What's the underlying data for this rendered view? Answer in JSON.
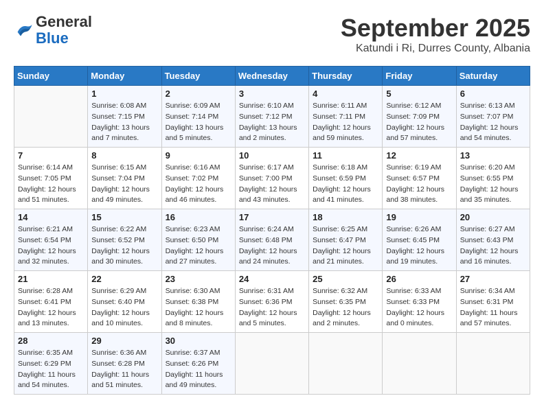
{
  "header": {
    "logo": {
      "general": "General",
      "blue": "Blue"
    },
    "title": "September 2025",
    "subtitle": "Katundi i Ri, Durres County, Albania"
  },
  "weekdays": [
    "Sunday",
    "Monday",
    "Tuesday",
    "Wednesday",
    "Thursday",
    "Friday",
    "Saturday"
  ],
  "weeks": [
    [
      {
        "day": "",
        "info": ""
      },
      {
        "day": "1",
        "info": "Sunrise: 6:08 AM\nSunset: 7:15 PM\nDaylight: 13 hours\nand 7 minutes."
      },
      {
        "day": "2",
        "info": "Sunrise: 6:09 AM\nSunset: 7:14 PM\nDaylight: 13 hours\nand 5 minutes."
      },
      {
        "day": "3",
        "info": "Sunrise: 6:10 AM\nSunset: 7:12 PM\nDaylight: 13 hours\nand 2 minutes."
      },
      {
        "day": "4",
        "info": "Sunrise: 6:11 AM\nSunset: 7:11 PM\nDaylight: 12 hours\nand 59 minutes."
      },
      {
        "day": "5",
        "info": "Sunrise: 6:12 AM\nSunset: 7:09 PM\nDaylight: 12 hours\nand 57 minutes."
      },
      {
        "day": "6",
        "info": "Sunrise: 6:13 AM\nSunset: 7:07 PM\nDaylight: 12 hours\nand 54 minutes."
      }
    ],
    [
      {
        "day": "7",
        "info": "Sunrise: 6:14 AM\nSunset: 7:05 PM\nDaylight: 12 hours\nand 51 minutes."
      },
      {
        "day": "8",
        "info": "Sunrise: 6:15 AM\nSunset: 7:04 PM\nDaylight: 12 hours\nand 49 minutes."
      },
      {
        "day": "9",
        "info": "Sunrise: 6:16 AM\nSunset: 7:02 PM\nDaylight: 12 hours\nand 46 minutes."
      },
      {
        "day": "10",
        "info": "Sunrise: 6:17 AM\nSunset: 7:00 PM\nDaylight: 12 hours\nand 43 minutes."
      },
      {
        "day": "11",
        "info": "Sunrise: 6:18 AM\nSunset: 6:59 PM\nDaylight: 12 hours\nand 41 minutes."
      },
      {
        "day": "12",
        "info": "Sunrise: 6:19 AM\nSunset: 6:57 PM\nDaylight: 12 hours\nand 38 minutes."
      },
      {
        "day": "13",
        "info": "Sunrise: 6:20 AM\nSunset: 6:55 PM\nDaylight: 12 hours\nand 35 minutes."
      }
    ],
    [
      {
        "day": "14",
        "info": "Sunrise: 6:21 AM\nSunset: 6:54 PM\nDaylight: 12 hours\nand 32 minutes."
      },
      {
        "day": "15",
        "info": "Sunrise: 6:22 AM\nSunset: 6:52 PM\nDaylight: 12 hours\nand 30 minutes."
      },
      {
        "day": "16",
        "info": "Sunrise: 6:23 AM\nSunset: 6:50 PM\nDaylight: 12 hours\nand 27 minutes."
      },
      {
        "day": "17",
        "info": "Sunrise: 6:24 AM\nSunset: 6:48 PM\nDaylight: 12 hours\nand 24 minutes."
      },
      {
        "day": "18",
        "info": "Sunrise: 6:25 AM\nSunset: 6:47 PM\nDaylight: 12 hours\nand 21 minutes."
      },
      {
        "day": "19",
        "info": "Sunrise: 6:26 AM\nSunset: 6:45 PM\nDaylight: 12 hours\nand 19 minutes."
      },
      {
        "day": "20",
        "info": "Sunrise: 6:27 AM\nSunset: 6:43 PM\nDaylight: 12 hours\nand 16 minutes."
      }
    ],
    [
      {
        "day": "21",
        "info": "Sunrise: 6:28 AM\nSunset: 6:41 PM\nDaylight: 12 hours\nand 13 minutes."
      },
      {
        "day": "22",
        "info": "Sunrise: 6:29 AM\nSunset: 6:40 PM\nDaylight: 12 hours\nand 10 minutes."
      },
      {
        "day": "23",
        "info": "Sunrise: 6:30 AM\nSunset: 6:38 PM\nDaylight: 12 hours\nand 8 minutes."
      },
      {
        "day": "24",
        "info": "Sunrise: 6:31 AM\nSunset: 6:36 PM\nDaylight: 12 hours\nand 5 minutes."
      },
      {
        "day": "25",
        "info": "Sunrise: 6:32 AM\nSunset: 6:35 PM\nDaylight: 12 hours\nand 2 minutes."
      },
      {
        "day": "26",
        "info": "Sunrise: 6:33 AM\nSunset: 6:33 PM\nDaylight: 12 hours\nand 0 minutes."
      },
      {
        "day": "27",
        "info": "Sunrise: 6:34 AM\nSunset: 6:31 PM\nDaylight: 11 hours\nand 57 minutes."
      }
    ],
    [
      {
        "day": "28",
        "info": "Sunrise: 6:35 AM\nSunset: 6:29 PM\nDaylight: 11 hours\nand 54 minutes."
      },
      {
        "day": "29",
        "info": "Sunrise: 6:36 AM\nSunset: 6:28 PM\nDaylight: 11 hours\nand 51 minutes."
      },
      {
        "day": "30",
        "info": "Sunrise: 6:37 AM\nSunset: 6:26 PM\nDaylight: 11 hours\nand 49 minutes."
      },
      {
        "day": "",
        "info": ""
      },
      {
        "day": "",
        "info": ""
      },
      {
        "day": "",
        "info": ""
      },
      {
        "day": "",
        "info": ""
      }
    ]
  ]
}
